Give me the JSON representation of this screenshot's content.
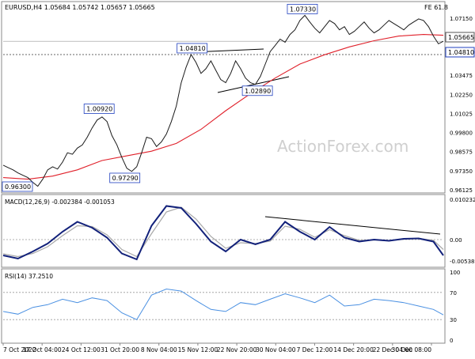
{
  "title": "EURUSD,H4  1.05684 1.05742 1.05657 1.05665",
  "fe_label": "FE 61.8",
  "watermark": "ActionForex.com",
  "current_price": "1.05665",
  "level_price": "1.04810",
  "colors": {
    "price": "#1a1a1a",
    "ma": "#e0202a",
    "macd": "#12217a",
    "signal": "#a8a8a8",
    "rsi": "#4a90e2",
    "label_border": "#1f3fbf",
    "panel_border": "#888888"
  },
  "chart_data": [
    {
      "type": "line",
      "name": "price",
      "ylim": [
        0.9612,
        1.074
      ],
      "y_ticks": [
        "1.07150",
        "1.05665",
        "1.04810",
        "1.03475",
        "1.02250",
        "1.01025",
        "0.99800",
        "0.98575",
        "0.97350",
        "0.96125"
      ],
      "annotations": [
        {
          "text": "1.07330",
          "x": 60.5,
          "y": 1.0733
        },
        {
          "text": "1.04810",
          "x": 38.2,
          "y": 1.0481
        },
        {
          "text": "1.02890",
          "x": 51.4,
          "y": 1.0289
        },
        {
          "text": "1.00920",
          "x": 19.4,
          "y": 1.0092
        },
        {
          "text": "0.97290",
          "x": 24.6,
          "y": 0.9729
        },
        {
          "text": "0.96300",
          "x": 5.4,
          "y": 0.963
        }
      ],
      "x": [
        0,
        1,
        2,
        3,
        4,
        5,
        6,
        7,
        8,
        9,
        10,
        11,
        12,
        13,
        14,
        15,
        16,
        17,
        18,
        19,
        20,
        21,
        22,
        23,
        24,
        25,
        26,
        27,
        28,
        29,
        30,
        31,
        32,
        33,
        34,
        35,
        36,
        37,
        38,
        39,
        40,
        41,
        42,
        43,
        44,
        45,
        46,
        47,
        48,
        49,
        50,
        51,
        52,
        53,
        54,
        55,
        56,
        57,
        58,
        59,
        60,
        61,
        62,
        63,
        64,
        65,
        66,
        67,
        68,
        69,
        70,
        71,
        72,
        73,
        74,
        75,
        76,
        77,
        78,
        79,
        80,
        81,
        82,
        83,
        84,
        85,
        86,
        87,
        88,
        89
      ],
      "values": [
        0.977,
        0.9755,
        0.974,
        0.972,
        0.9705,
        0.969,
        0.966,
        0.9635,
        0.968,
        0.974,
        0.976,
        0.9745,
        0.979,
        0.985,
        0.984,
        0.988,
        0.99,
        0.995,
        1.001,
        1.006,
        1.008,
        1.005,
        0.996,
        0.99,
        0.982,
        0.975,
        0.973,
        0.976,
        0.985,
        0.995,
        0.994,
        0.989,
        0.992,
        0.997,
        1.005,
        1.015,
        1.03,
        1.04,
        1.0481,
        1.043,
        1.036,
        1.039,
        1.044,
        1.038,
        1.032,
        1.03,
        1.036,
        1.044,
        1.039,
        1.033,
        1.03,
        1.0289,
        1.034,
        1.042,
        1.05,
        1.054,
        1.058,
        1.056,
        1.061,
        1.064,
        1.07,
        1.0733,
        1.069,
        1.065,
        1.062,
        1.066,
        1.07,
        1.068,
        1.064,
        1.066,
        1.061,
        1.063,
        1.066,
        1.069,
        1.065,
        1.062,
        1.064,
        1.067,
        1.07,
        1.068,
        1.066,
        1.064,
        1.067,
        1.069,
        1.071,
        1.07,
        1.066,
        1.06,
        1.055,
        1.0566
      ]
    },
    {
      "type": "line",
      "name": "MA",
      "x": [
        0,
        5,
        10,
        15,
        20,
        25,
        30,
        35,
        40,
        45,
        50,
        55,
        60,
        65,
        70,
        75,
        80,
        85,
        89
      ],
      "values": [
        0.969,
        0.968,
        0.97,
        0.974,
        0.98,
        0.983,
        0.986,
        0.991,
        1.0,
        1.012,
        1.023,
        1.033,
        1.042,
        1.048,
        1.053,
        1.057,
        1.06,
        1.061,
        1.0605
      ]
    },
    {
      "type": "line",
      "name": "MACD(12,26,9) -0.002384 -0.001053",
      "ylim": [
        -0.0062,
        0.0106
      ],
      "y_ticks": [
        "0.010232",
        "0.00",
        "-0.005389"
      ],
      "x": [
        0,
        3,
        6,
        9,
        12,
        15,
        18,
        21,
        24,
        27,
        30,
        33,
        36,
        39,
        42,
        45,
        48,
        51,
        54,
        57,
        60,
        63,
        66,
        69,
        72,
        75,
        78,
        81,
        84,
        87,
        89
      ],
      "values": [
        -0.004,
        -0.0048,
        -0.003,
        -0.001,
        0.002,
        0.0045,
        0.003,
        0.0005,
        -0.0035,
        -0.005,
        0.0035,
        0.0085,
        0.008,
        0.004,
        -0.0005,
        -0.003,
        0.0,
        -0.0012,
        0.0,
        0.0045,
        0.002,
        0.0,
        0.0032,
        0.0005,
        -0.0005,
        0.0,
        -0.0003,
        0.0002,
        0.0003,
        -0.0005,
        -0.004
      ]
    },
    {
      "type": "line",
      "name": "signal",
      "x": [
        0,
        3,
        6,
        9,
        12,
        15,
        18,
        21,
        24,
        27,
        30,
        33,
        36,
        39,
        42,
        45,
        48,
        51,
        54,
        57,
        60,
        63,
        66,
        69,
        72,
        75,
        78,
        81,
        84,
        87,
        89
      ],
      "values": [
        -0.0036,
        -0.0043,
        -0.0035,
        -0.0018,
        0.001,
        0.0035,
        0.0033,
        0.0012,
        -0.0025,
        -0.0043,
        0.0015,
        0.007,
        0.0082,
        0.0052,
        0.0008,
        -0.0022,
        -0.0008,
        -0.001,
        -0.0004,
        0.0034,
        0.0026,
        0.0006,
        0.0025,
        0.001,
        -0.0002,
        -0.0001,
        -0.0003,
        0.0001,
        0.0003,
        -0.0002,
        -0.0025
      ]
    },
    {
      "type": "line",
      "name": "RSI(14) 37.2510",
      "ylim": [
        0,
        100
      ],
      "y_ticks": [
        "100",
        "70",
        "30",
        "0"
      ],
      "x": [
        0,
        3,
        6,
        9,
        12,
        15,
        18,
        21,
        24,
        27,
        30,
        33,
        36,
        39,
        42,
        45,
        48,
        51,
        54,
        57,
        60,
        63,
        66,
        69,
        72,
        75,
        78,
        81,
        84,
        87,
        89
      ],
      "values": [
        42,
        38,
        48,
        52,
        60,
        55,
        62,
        58,
        40,
        30,
        66,
        75,
        72,
        58,
        45,
        42,
        55,
        52,
        60,
        68,
        62,
        55,
        66,
        50,
        52,
        60,
        58,
        55,
        50,
        45,
        37
      ]
    }
  ],
  "x_labels": [
    "7 Oct 2022",
    "17 Oct 04:00",
    "24 Oct 12:00",
    "31 Oct 20:00",
    "8 Nov 04:00",
    "15 Nov 12:00",
    "22 Nov 20:00",
    "30 Nov 04:00",
    "7 Dec 12:00",
    "14 Dec 20:00",
    "22 Dec 04:00",
    "30 Dec 08:00"
  ]
}
